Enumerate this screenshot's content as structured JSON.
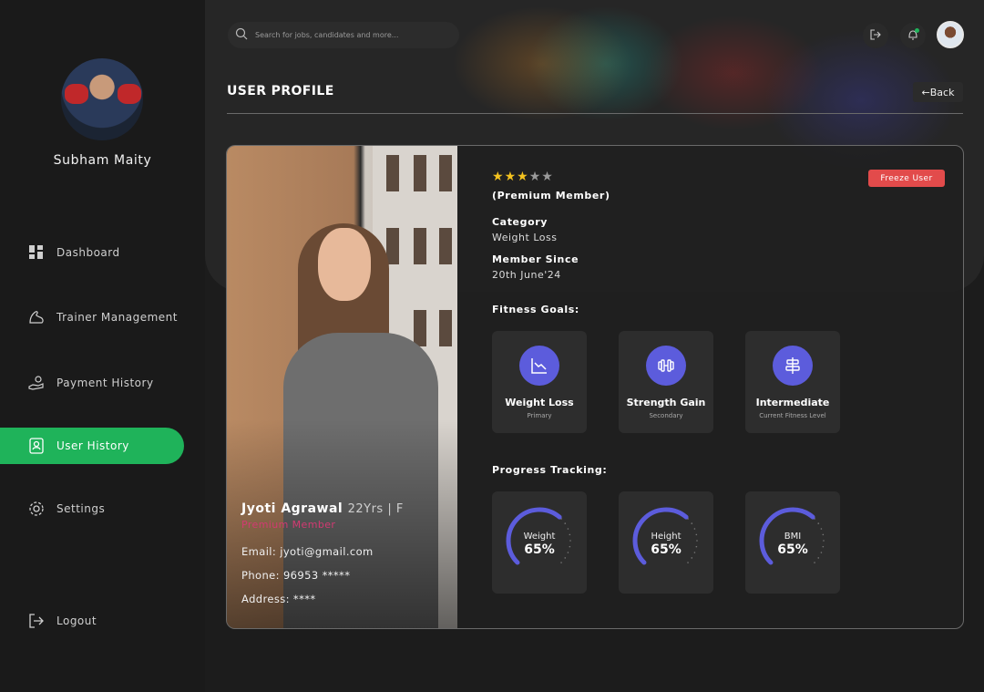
{
  "sidebar": {
    "profile_name": "Subham Maity",
    "items": [
      {
        "label": "Dashboard",
        "icon": "dashboard-grid-icon"
      },
      {
        "label": "Trainer Management",
        "icon": "bicep-icon"
      },
      {
        "label": "Payment History",
        "icon": "payment-hand-icon"
      },
      {
        "label": "User History",
        "icon": "user-history-icon",
        "active": true
      },
      {
        "label": "Settings",
        "icon": "gear-icon"
      }
    ],
    "logout_label": "Logout"
  },
  "header": {
    "search_placeholder": "Search for jobs, candidates and more...",
    "page_title": "USER PROFILE",
    "back_label": "←Back"
  },
  "profile": {
    "name": "Jyoti Agrawal",
    "meta": "22Yrs | F",
    "member_tag": "Premium Member",
    "email": "Email: jyoti@gmail.com",
    "phone": "Phone: 96953 *****",
    "address": "Address: ****",
    "rating": 3,
    "rating_max": 5,
    "member_type": "(Premium Member)",
    "category_label": "Category",
    "category_value": "Weight Loss",
    "since_label": "Member Since",
    "since_value": "20th June'24",
    "freeze_label": "Freeze User"
  },
  "fitness_goals": {
    "label": "Fitness Goals:",
    "items": [
      {
        "title": "Weight Loss",
        "sub": "Primary",
        "icon": "trend-down-icon"
      },
      {
        "title": "Strength Gain",
        "sub": "Secondary",
        "icon": "dumbbell-icon"
      },
      {
        "title": "Intermediate",
        "sub": "Current Fitness Level",
        "icon": "align-center-icon"
      }
    ]
  },
  "progress": {
    "label": "Progress Tracking:",
    "items": [
      {
        "label": "Weight",
        "value": "65%",
        "percent": 65
      },
      {
        "label": "Height",
        "value": "65%",
        "percent": 65
      },
      {
        "label": "BMI",
        "value": "65%",
        "percent": 65
      }
    ]
  },
  "colors": {
    "accent_green": "#1fb35a",
    "accent_purple": "#5c5cdc",
    "freeze_red": "#e24b4b",
    "member_pink": "#d23a72",
    "star_gold": "#f3c21f"
  }
}
